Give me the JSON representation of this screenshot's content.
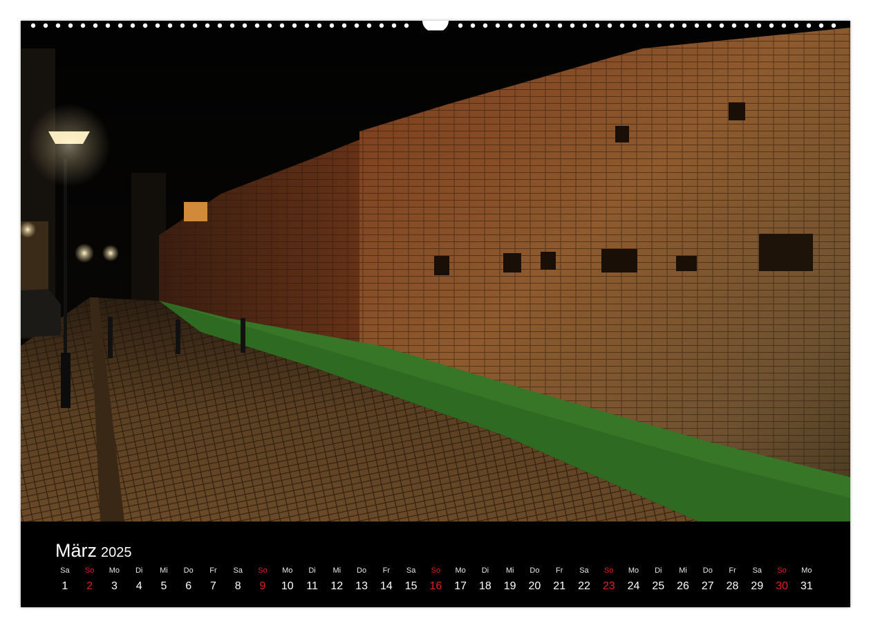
{
  "calendar": {
    "month": "März",
    "year": "2025",
    "days": [
      {
        "dow": "Sa",
        "num": "1",
        "sunday": false
      },
      {
        "dow": "So",
        "num": "2",
        "sunday": true
      },
      {
        "dow": "Mo",
        "num": "3",
        "sunday": false
      },
      {
        "dow": "Di",
        "num": "4",
        "sunday": false
      },
      {
        "dow": "Mi",
        "num": "5",
        "sunday": false
      },
      {
        "dow": "Do",
        "num": "6",
        "sunday": false
      },
      {
        "dow": "Fr",
        "num": "7",
        "sunday": false
      },
      {
        "dow": "Sa",
        "num": "8",
        "sunday": false
      },
      {
        "dow": "So",
        "num": "9",
        "sunday": true
      },
      {
        "dow": "Mo",
        "num": "10",
        "sunday": false
      },
      {
        "dow": "Di",
        "num": "11",
        "sunday": false
      },
      {
        "dow": "Mi",
        "num": "12",
        "sunday": false
      },
      {
        "dow": "Do",
        "num": "13",
        "sunday": false
      },
      {
        "dow": "Fr",
        "num": "14",
        "sunday": false
      },
      {
        "dow": "Sa",
        "num": "15",
        "sunday": false
      },
      {
        "dow": "So",
        "num": "16",
        "sunday": true
      },
      {
        "dow": "Mo",
        "num": "17",
        "sunday": false
      },
      {
        "dow": "Di",
        "num": "18",
        "sunday": false
      },
      {
        "dow": "Mi",
        "num": "19",
        "sunday": false
      },
      {
        "dow": "Do",
        "num": "20",
        "sunday": false
      },
      {
        "dow": "Fr",
        "num": "21",
        "sunday": false
      },
      {
        "dow": "Sa",
        "num": "22",
        "sunday": false
      },
      {
        "dow": "So",
        "num": "23",
        "sunday": true
      },
      {
        "dow": "Mo",
        "num": "24",
        "sunday": false
      },
      {
        "dow": "Di",
        "num": "25",
        "sunday": false
      },
      {
        "dow": "Mi",
        "num": "26",
        "sunday": false
      },
      {
        "dow": "Do",
        "num": "27",
        "sunday": false
      },
      {
        "dow": "Fr",
        "num": "28",
        "sunday": false
      },
      {
        "dow": "Sa",
        "num": "29",
        "sunday": false
      },
      {
        "dow": "So",
        "num": "30",
        "sunday": true
      },
      {
        "dow": "Mo",
        "num": "31",
        "sunday": false
      }
    ]
  },
  "colors": {
    "sunday": "#e02020",
    "text": "#ffffff",
    "background": "#000000",
    "brick": "#8a4a26",
    "grass": "#2f6a22",
    "cobblestone": "#5a3f22"
  },
  "photo": {
    "subject": "illuminated medieval brick city wall at night beside a wet cobblestone street with street lamps"
  }
}
